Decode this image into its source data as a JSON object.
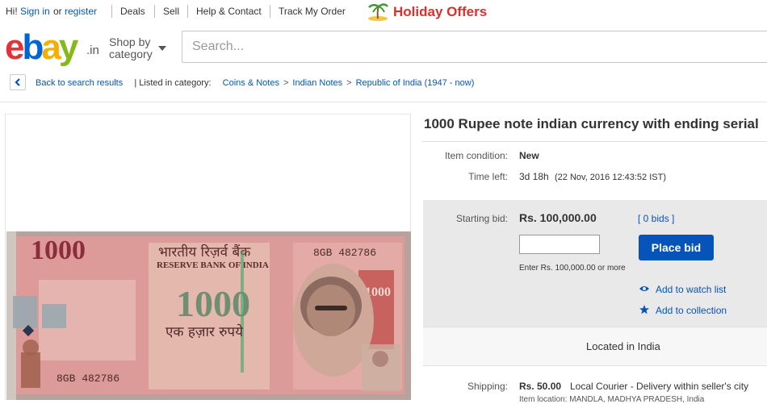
{
  "topbar": {
    "greeting": "Hi!",
    "sign_in": "Sign in",
    "or": "or",
    "register": "register",
    "deals": "Deals",
    "sell": "Sell",
    "help_contact": "Help & Contact",
    "track_order": "Track My Order",
    "promo": "Holiday Offers"
  },
  "header": {
    "logo_letters": [
      "e",
      "b",
      "a",
      "y"
    ],
    "logo_suffix": ".in",
    "shop_by_line1": "Shop by",
    "shop_by_line2": "category",
    "search_placeholder": "Search..."
  },
  "breadcrumb": {
    "back": "Back to search results",
    "listed_in": "| Listed in category:",
    "items": [
      "Coins & Notes",
      "Indian Notes",
      "Republic of India (1947 - now)"
    ]
  },
  "item": {
    "title": "1000 Rupee note indian currency with ending serial",
    "condition_label": "Item condition:",
    "condition": "New",
    "time_left_label": "Time left:",
    "time_left": "3d 18h",
    "time_left_detail": "(22 Nov, 2016  12:43:52 IST)",
    "starting_bid_label": "Starting bid:",
    "starting_bid": "Rs. 100,000.00",
    "bids": "[ 0 bids ]",
    "bid_input_value": "",
    "place_bid": "Place bid",
    "enter_min": "Enter Rs. 100,000.00 or more",
    "watch": "Add to watch list",
    "collection": "Add to collection",
    "located": "Located in India",
    "shipping_label": "Shipping:",
    "shipping_price": "Rs. 50.00",
    "shipping_method": "Local Courier - Delivery within seller's city",
    "item_location": "Item location: MANDLA, MADHYA PRADESH, India"
  },
  "banknote": {
    "denomination": "1000",
    "serial": "8GB 482786",
    "bank_hindi": "भारतीय रिज़र्व बैंक",
    "bank_english": "RESERVE BANK OF INDIA",
    "amount_hindi": "एक हज़ार रुपये"
  },
  "colors": {
    "link": "#0654ba",
    "button": "#0654ba",
    "promo": "#d9302c",
    "bid_panel": "#e9e9e9",
    "note_pink": "#d89090"
  }
}
